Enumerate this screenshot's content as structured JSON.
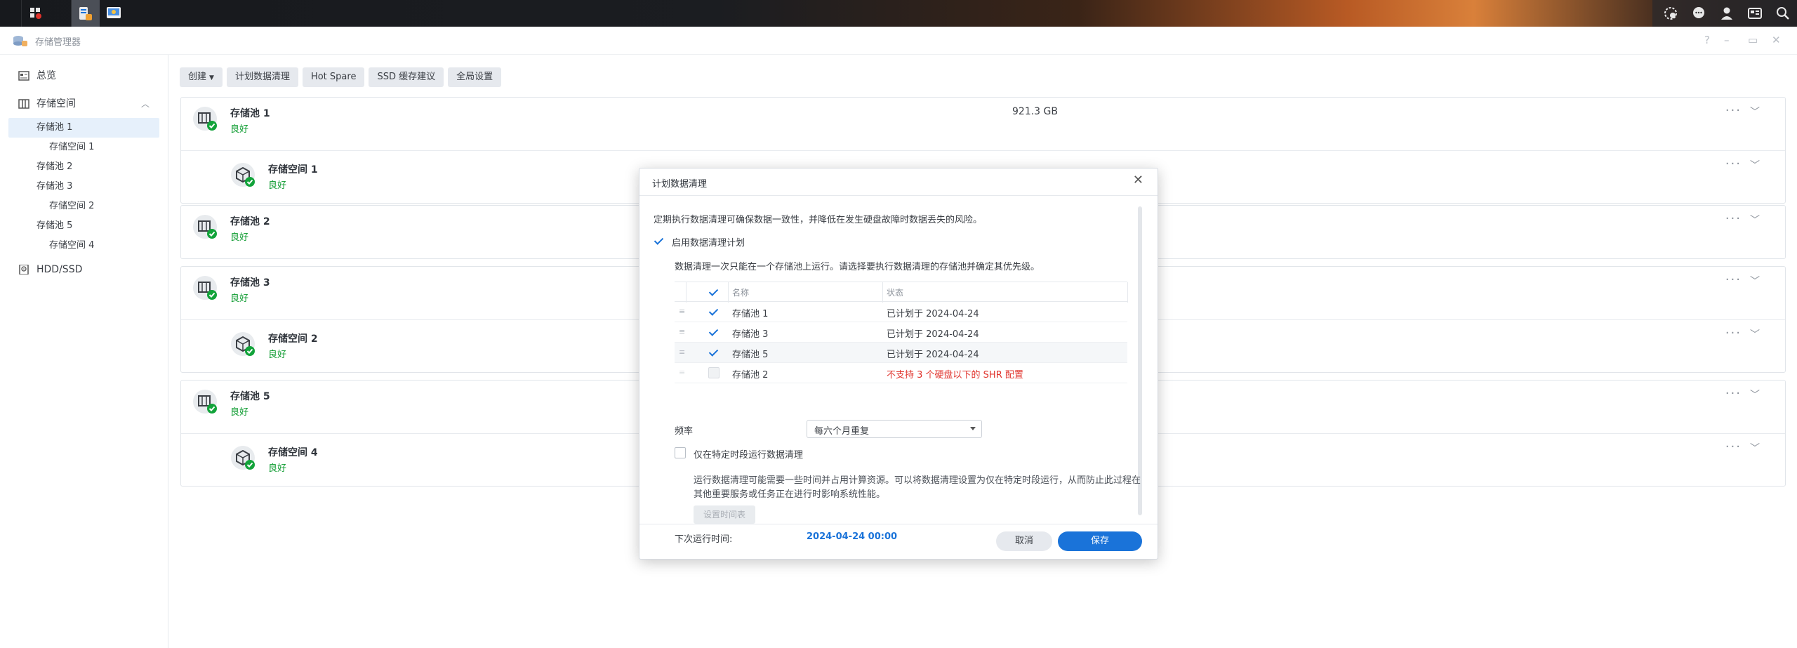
{
  "app": {
    "title": "存储管理器"
  },
  "sidebar": {
    "overview": "总览",
    "storage_space": "存储空间",
    "items": [
      {
        "label": "存储池 1"
      },
      {
        "label": "存储空间 1"
      },
      {
        "label": "存储池 2"
      },
      {
        "label": "存储池 3"
      },
      {
        "label": "存储空间 2"
      },
      {
        "label": "存储池 5"
      },
      {
        "label": "存储空间 4"
      }
    ],
    "hdd": "HDD/SSD"
  },
  "toolbar": {
    "create": "创建",
    "scrub_schedule": "计划数据清理",
    "hot_spare": "Hot Spare",
    "ssd_cache": "SSD 缓存建议",
    "global_settings": "全局设置"
  },
  "pools": [
    {
      "name": "存储池 1",
      "status": "良好",
      "size": "921.3 GB",
      "volume": {
        "name": "存储空间 1",
        "status": "良好"
      }
    },
    {
      "name": "存储池 2",
      "status": "良好"
    },
    {
      "name": "存储池 3",
      "status": "良好",
      "volume": {
        "name": "存储空间 2",
        "status": "良好"
      }
    },
    {
      "name": "存储池 5",
      "status": "良好",
      "volume": {
        "name": "存储空间 4",
        "status": "良好"
      }
    }
  ],
  "dialog": {
    "title": "计划数据清理",
    "description": "定期执行数据清理可确保数据一致性，并降低在发生硬盘故障时数据丢失的风险。",
    "enable_label": "启用数据清理计划",
    "note": "数据清理一次只能在一个存储池上运行。请选择要执行数据清理的存储池并确定其优先级。",
    "columns": {
      "name": "名称",
      "status": "状态"
    },
    "rows": [
      {
        "name": "存储池 1",
        "status": "已计划于 2024-04-24",
        "checked": true
      },
      {
        "name": "存储池 3",
        "status": "已计划于 2024-04-24",
        "checked": true
      },
      {
        "name": "存储池 5",
        "status": "已计划于 2024-04-24",
        "checked": true
      },
      {
        "name": "存储池 2",
        "status": "不支持 3 个硬盘以下的 SHR 配置",
        "checked": false
      }
    ],
    "frequency_label": "频率",
    "frequency_value": "每六个月重复",
    "window_label": "仅在特定时段运行数据清理",
    "window_hint": "运行数据清理可能需要一些时间并占用计算资源。可以将数据清理设置为仅在特定时段运行，从而防止此过程在其他重要服务或任务正在进行时影响系统性能。",
    "set_time_button": "设置时间表",
    "next_run_label": "下次运行时间:",
    "next_run_value": "2024-04-24 00:00",
    "cancel": "取消",
    "save": "保存"
  }
}
